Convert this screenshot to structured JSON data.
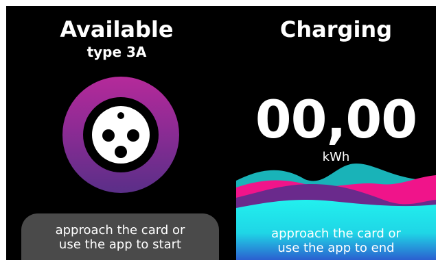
{
  "left_panel": {
    "status": "Available",
    "connector_type": "type 3A",
    "icon": "type-3a-connector-icon",
    "hint_line1": "approach the card or",
    "hint_line2": "use the app to start"
  },
  "right_panel": {
    "status": "Charging",
    "energy_value": "00,00",
    "energy_unit": "kWh",
    "hint_line1": "approach the card or",
    "hint_line2": "use the app to end"
  },
  "colors": {
    "background": "#000000",
    "ring_top": "#b52a9a",
    "ring_bottom": "#5a2f88",
    "hint_box": "#4a4a4a",
    "wave_teal": "#19b3b8",
    "wave_pink": "#f0148a",
    "wave_purple": "#6a2a8c",
    "wave_cyan": "#22f0ee",
    "wave_blue": "#2b5fd0"
  }
}
